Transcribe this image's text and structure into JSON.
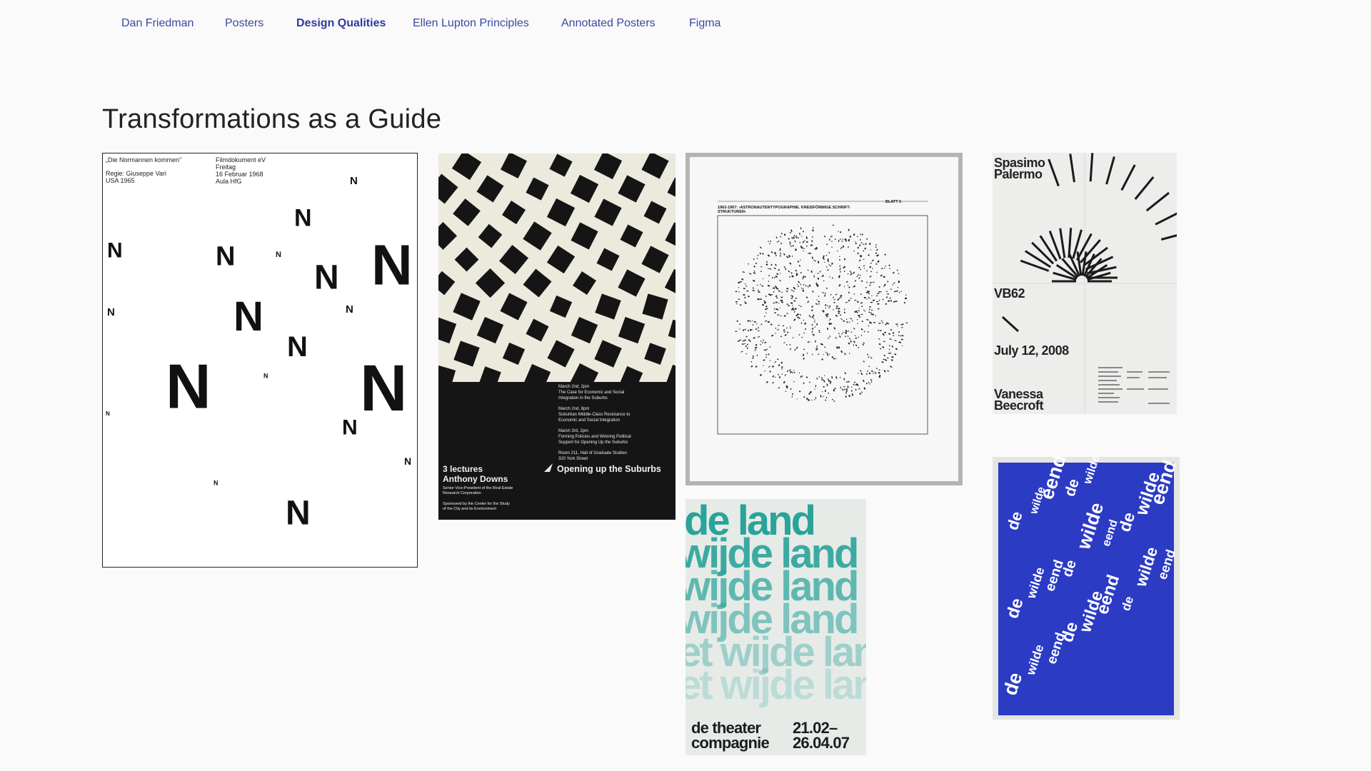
{
  "nav": {
    "items": [
      {
        "label": "Dan Friedman",
        "active": false
      },
      {
        "label": "Posters",
        "active": false
      },
      {
        "label": "Design Qualities",
        "active": true
      },
      {
        "label": "Ellen Lupton Principles",
        "active": false
      },
      {
        "label": "Annotated Posters",
        "active": false
      },
      {
        "label": "Figma",
        "active": false
      }
    ]
  },
  "page": {
    "title": "Transformations as a Guide"
  },
  "posters": {
    "normannen": {
      "line1": "„Die Normannen kommen\"",
      "line2": "Regie: Giuseppe Vari",
      "line3": "USA 1965",
      "line4": "Filmdokument eV",
      "line5": "Freitag",
      "line6": "16 Februar 1968",
      "line7": "Aula HfG",
      "letter": "N"
    },
    "suburbs": {
      "events": [
        "March 2nd, 2pm",
        "The Case for Economic and Social",
        "Integration in the Suburbs",
        "March 2nd, 8pm",
        "Suburban Middle-Class Resistance to",
        "Economic and Social Integration",
        "March 3rd, 2pm",
        "Forming Policies and Winning Political",
        "Support for Opening Up the Suburbs",
        "Room 211, Hall of Graduate Studies",
        "320 York Street"
      ],
      "lectures": "3 lectures",
      "speaker": "Anthony Downs",
      "speaker_title_1": "Senior Vice-President of the Real Estate",
      "speaker_title_2": "Research Corporation",
      "sponsor_1": "Sponsored by the Center for the Study",
      "sponsor_2": "of the City and its Environment",
      "headline": "Opening up the Suburbs"
    },
    "astronauten": {
      "heading_1": "1963-1967: ›ASTRONAUTENTYPOGRAPHIE. KREISFÖRMIGE SCHRIFT-",
      "heading_2": "STRUKTUREN‹",
      "sheet": "BLATT 5"
    },
    "vb62": {
      "line1": "Spasimo",
      "line2": "Palermo",
      "code": "VB62",
      "date": "July 12, 2008",
      "name1": "Vanessa",
      "name2": "Beecroft"
    },
    "deland": {
      "lines": [
        "de land",
        "wijde land",
        "wijde land",
        "wijde land",
        "et wijde land",
        "et wijde land"
      ],
      "company_1": "de theater",
      "company_2": "compagnie",
      "dates_1": "21.02–",
      "dates_2": "26.04.07"
    },
    "wildeeend": {
      "word1": "de",
      "word2": "wilde",
      "word3": "eend"
    }
  },
  "colors": {
    "nav_text": "#3a4aa0",
    "deland_teal": "#2aa39a",
    "wilde_blue": "#2b3bc4"
  }
}
